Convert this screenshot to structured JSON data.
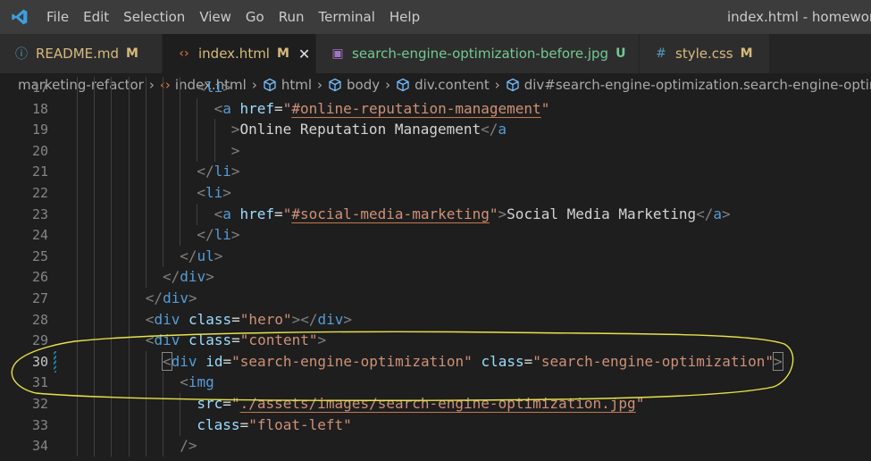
{
  "menu": {
    "items": [
      "File",
      "Edit",
      "Selection",
      "View",
      "Go",
      "Run",
      "Terminal",
      "Help"
    ],
    "window_title": "index.html - homework"
  },
  "tabs": [
    {
      "label": "README.md",
      "status": "M",
      "icon": "info-icon",
      "active": false,
      "color": "#d7ba7d"
    },
    {
      "label": "index.html",
      "status": "M",
      "icon": "html-icon",
      "active": true,
      "color": "#d7ba7d"
    },
    {
      "label": "search-engine-optimization-before.jpg",
      "status": "U",
      "icon": "image-icon",
      "active": false,
      "color": "#73c991"
    },
    {
      "label": "style.css",
      "status": "M",
      "icon": "css-icon",
      "active": false,
      "color": "#d7ba7d"
    }
  ],
  "breadcrumb": [
    "marketing-refactor",
    "index.html",
    "html",
    "body",
    "div.content",
    "div#search-engine-optimization.search-engine-optimization"
  ],
  "editor": {
    "current_line": "30",
    "lines": [
      {
        "n": "17",
        "indent": 7,
        "tokens": [
          [
            "p",
            "<"
          ],
          [
            "g",
            "li"
          ],
          [
            "p",
            ">"
          ]
        ]
      },
      {
        "n": "18",
        "indent": 8,
        "tokens": [
          [
            "p",
            "<"
          ],
          [
            "g",
            "a"
          ],
          [
            "x",
            " "
          ],
          [
            "a",
            "href"
          ],
          [
            "e",
            "="
          ],
          [
            "s",
            "\""
          ],
          [
            "sq",
            "#online-reputation-management"
          ],
          [
            "s",
            "\""
          ]
        ]
      },
      {
        "n": "19",
        "indent": 9,
        "tokens": [
          [
            "p",
            ">"
          ],
          [
            "x",
            "Online Reputation Management"
          ],
          [
            "p",
            "</"
          ],
          [
            "g",
            "a"
          ]
        ]
      },
      {
        "n": "20",
        "indent": 9,
        "tokens": [
          [
            "p",
            ">"
          ]
        ]
      },
      {
        "n": "21",
        "indent": 7,
        "tokens": [
          [
            "p",
            "</"
          ],
          [
            "g",
            "li"
          ],
          [
            "p",
            ">"
          ]
        ]
      },
      {
        "n": "22",
        "indent": 7,
        "tokens": [
          [
            "p",
            "<"
          ],
          [
            "g",
            "li"
          ],
          [
            "p",
            ">"
          ]
        ]
      },
      {
        "n": "23",
        "indent": 8,
        "tokens": [
          [
            "p",
            "<"
          ],
          [
            "g",
            "a"
          ],
          [
            "x",
            " "
          ],
          [
            "a",
            "href"
          ],
          [
            "e",
            "="
          ],
          [
            "s",
            "\""
          ],
          [
            "sq",
            "#social-media-marketing"
          ],
          [
            "s",
            "\""
          ],
          [
            "p",
            ">"
          ],
          [
            "x",
            "Social Media Marketing"
          ],
          [
            "p",
            "</"
          ],
          [
            "g",
            "a"
          ],
          [
            "p",
            ">"
          ]
        ]
      },
      {
        "n": "24",
        "indent": 7,
        "tokens": [
          [
            "p",
            "</"
          ],
          [
            "g",
            "li"
          ],
          [
            "p",
            ">"
          ]
        ]
      },
      {
        "n": "25",
        "indent": 6,
        "tokens": [
          [
            "p",
            "</"
          ],
          [
            "g",
            "ul"
          ],
          [
            "p",
            ">"
          ]
        ]
      },
      {
        "n": "26",
        "indent": 5,
        "tokens": [
          [
            "p",
            "</"
          ],
          [
            "g",
            "div"
          ],
          [
            "p",
            ">"
          ]
        ]
      },
      {
        "n": "27",
        "indent": 4,
        "tokens": [
          [
            "p",
            "</"
          ],
          [
            "g",
            "div"
          ],
          [
            "p",
            ">"
          ]
        ]
      },
      {
        "n": "28",
        "indent": 4,
        "tokens": [
          [
            "p",
            "<"
          ],
          [
            "g",
            "div"
          ],
          [
            "x",
            " "
          ],
          [
            "a",
            "class"
          ],
          [
            "e",
            "="
          ],
          [
            "s",
            "\"hero\""
          ],
          [
            "p",
            "></"
          ],
          [
            "g",
            "div"
          ],
          [
            "p",
            ">"
          ]
        ]
      },
      {
        "n": "29",
        "indent": 4,
        "tokens": [
          [
            "p",
            "<"
          ],
          [
            "g",
            "div"
          ],
          [
            "x",
            " "
          ],
          [
            "a",
            "class"
          ],
          [
            "e",
            "="
          ],
          [
            "s",
            "\"content\""
          ],
          [
            "p",
            ">"
          ]
        ]
      },
      {
        "n": "30",
        "indent": 5,
        "tokens": [
          [
            "bp",
            "<"
          ],
          [
            "g",
            "div"
          ],
          [
            "x",
            " "
          ],
          [
            "a",
            "id"
          ],
          [
            "e",
            "="
          ],
          [
            "s",
            "\"search-engine-optimization\""
          ],
          [
            "x",
            " "
          ],
          [
            "a",
            "class"
          ],
          [
            "e",
            "="
          ],
          [
            "s",
            "\"search-engine-optimization\""
          ],
          [
            "bp",
            ">"
          ]
        ]
      },
      {
        "n": "31",
        "indent": 6,
        "tokens": [
          [
            "p",
            "<"
          ],
          [
            "g",
            "img"
          ]
        ]
      },
      {
        "n": "32",
        "indent": 7,
        "tokens": [
          [
            "a",
            "src"
          ],
          [
            "e",
            "="
          ],
          [
            "s",
            "\""
          ],
          [
            "sq",
            "./assets/images/search-engine-optimization.jpg"
          ],
          [
            "s",
            "\""
          ]
        ]
      },
      {
        "n": "33",
        "indent": 7,
        "tokens": [
          [
            "a",
            "class"
          ],
          [
            "e",
            "="
          ],
          [
            "s",
            "\"float-left\""
          ]
        ]
      },
      {
        "n": "34",
        "indent": 6,
        "tokens": [
          [
            "p",
            "/>"
          ]
        ]
      }
    ]
  }
}
